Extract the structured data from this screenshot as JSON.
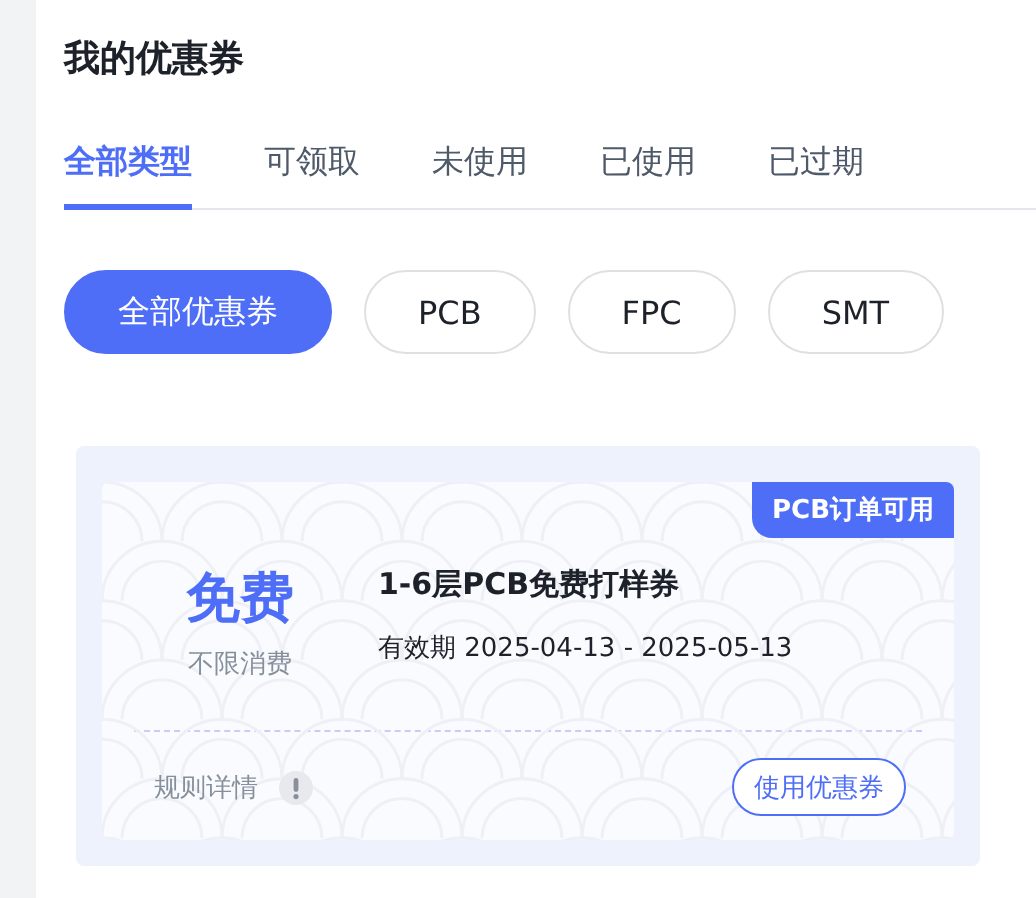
{
  "title": "我的优惠券",
  "tabs": [
    {
      "label": "全部类型",
      "selected": true
    },
    {
      "label": "可领取",
      "selected": false
    },
    {
      "label": "未使用",
      "selected": false
    },
    {
      "label": "已使用",
      "selected": false
    },
    {
      "label": "已过期",
      "selected": false
    }
  ],
  "filters": [
    {
      "label": "全部优惠券",
      "selected": true
    },
    {
      "label": "PCB",
      "selected": false
    },
    {
      "label": "FPC",
      "selected": false
    },
    {
      "label": "SMT",
      "selected": false
    }
  ],
  "coupons": [
    {
      "tag": "PCB订单可用",
      "amount": "免费",
      "condition": "不限消费",
      "name": "1-6层PCB免费打样券",
      "validity": "有效期 2025-04-13 - 2025-05-13",
      "rules": "规则详情",
      "action": "使用优惠券"
    }
  ]
}
